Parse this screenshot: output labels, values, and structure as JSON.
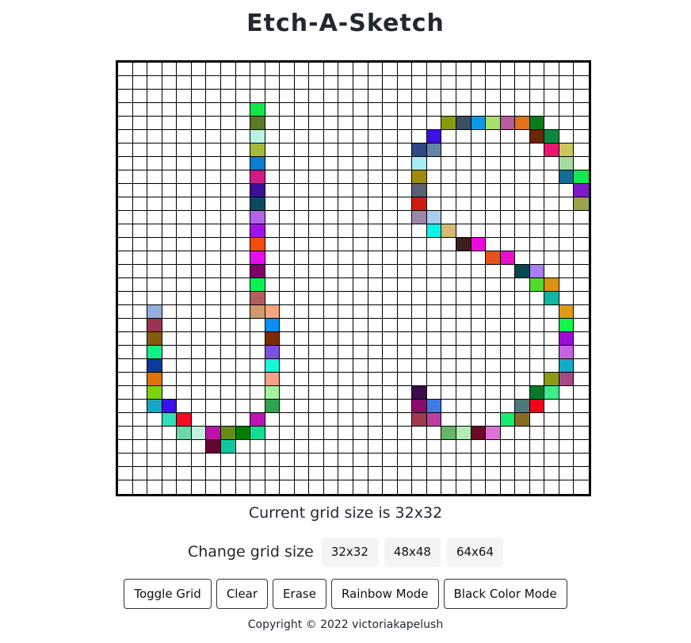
{
  "title": "Etch-A-Sketch",
  "grid": {
    "size": 32,
    "painted": [
      [
        3,
        9,
        "#11e84a"
      ],
      [
        4,
        9,
        "#5a7a2a"
      ],
      [
        5,
        9,
        "#b9f2e4"
      ],
      [
        6,
        9,
        "#a7b83a"
      ],
      [
        7,
        9,
        "#0a7fcf"
      ],
      [
        8,
        9,
        "#d21a86"
      ],
      [
        9,
        9,
        "#3a0f9a"
      ],
      [
        10,
        9,
        "#0b4a63"
      ],
      [
        11,
        9,
        "#b264e6"
      ],
      [
        12,
        9,
        "#a112ea"
      ],
      [
        13,
        9,
        "#f24e09"
      ],
      [
        14,
        9,
        "#e40ef0"
      ],
      [
        15,
        9,
        "#80006a"
      ],
      [
        16,
        9,
        "#09f254"
      ],
      [
        17,
        9,
        "#b1605f"
      ],
      [
        18,
        9,
        "#d09a6e"
      ],
      [
        18,
        10,
        "#f5a57c"
      ],
      [
        19,
        10,
        "#0a8ef0"
      ],
      [
        20,
        10,
        "#7b2b03"
      ],
      [
        21,
        10,
        "#7b4fe0"
      ],
      [
        22,
        10,
        "#17f8d8"
      ],
      [
        23,
        10,
        "#f5a28a"
      ],
      [
        24,
        10,
        "#a6f29c"
      ],
      [
        25,
        10,
        "#2ea44e"
      ],
      [
        26,
        9,
        "#bd16b3"
      ],
      [
        27,
        9,
        "#12dd93"
      ],
      [
        27,
        8,
        "#008000"
      ],
      [
        27,
        7,
        "#668c15"
      ],
      [
        27,
        6,
        "#bd11a9"
      ],
      [
        28,
        6,
        "#650532"
      ],
      [
        28,
        7,
        "#11c79f"
      ],
      [
        27,
        5,
        "#c6f0de"
      ],
      [
        27,
        4,
        "#6bd6a8"
      ],
      [
        26,
        4,
        "#f40b25"
      ],
      [
        26,
        3,
        "#2fdfb6"
      ],
      [
        25,
        3,
        "#3a0ff0"
      ],
      [
        24,
        2,
        "#7fd30d"
      ],
      [
        25,
        2,
        "#18a6c8"
      ],
      [
        23,
        2,
        "#e07008"
      ],
      [
        22,
        2,
        "#083b9a"
      ],
      [
        21,
        2,
        "#12f08a"
      ],
      [
        20,
        2,
        "#845b0a"
      ],
      [
        19,
        2,
        "#9a3550"
      ],
      [
        18,
        2,
        "#92aee0"
      ],
      [
        4,
        22,
        "#889b0d"
      ],
      [
        4,
        23,
        "#3b4e63"
      ],
      [
        4,
        24,
        "#0b99e3"
      ],
      [
        4,
        25,
        "#a8df6a"
      ],
      [
        4,
        26,
        "#ba5c99"
      ],
      [
        4,
        27,
        "#e0721c"
      ],
      [
        4,
        28,
        "#0b7a1b"
      ],
      [
        5,
        28,
        "#6b2703"
      ],
      [
        5,
        29,
        "#0a8a3f"
      ],
      [
        6,
        29,
        "#ec1574"
      ],
      [
        6,
        30,
        "#c9c75c"
      ],
      [
        7,
        30,
        "#a4dca4"
      ],
      [
        8,
        30,
        "#126f93"
      ],
      [
        8,
        31,
        "#13e84e"
      ],
      [
        9,
        31,
        "#7e1ac8"
      ],
      [
        10,
        31,
        "#9aa34a"
      ],
      [
        5,
        21,
        "#3d0fe3"
      ],
      [
        6,
        20,
        "#2d4a86"
      ],
      [
        6,
        21,
        "#6286a6"
      ],
      [
        7,
        20,
        "#a7edf2"
      ],
      [
        8,
        20,
        "#a08a09"
      ],
      [
        9,
        20,
        "#596173"
      ],
      [
        10,
        20,
        "#d21a14"
      ],
      [
        11,
        20,
        "#9a86a6"
      ],
      [
        11,
        21,
        "#a9cdf2"
      ],
      [
        12,
        21,
        "#0af2ea"
      ],
      [
        12,
        22,
        "#d4b973"
      ],
      [
        13,
        23,
        "#3d1d1d"
      ],
      [
        13,
        24,
        "#ec0adf"
      ],
      [
        14,
        25,
        "#e5521c"
      ],
      [
        14,
        26,
        "#ea10ca"
      ],
      [
        15,
        27,
        "#05494e"
      ],
      [
        15,
        28,
        "#a97cf8"
      ],
      [
        16,
        28,
        "#55d92e"
      ],
      [
        16,
        29,
        "#dc9211"
      ],
      [
        17,
        29,
        "#12b79f"
      ],
      [
        18,
        30,
        "#e09a13"
      ],
      [
        19,
        30,
        "#12f84a"
      ],
      [
        20,
        30,
        "#9c0ad5"
      ],
      [
        21,
        30,
        "#c664e0"
      ],
      [
        22,
        30,
        "#13adc9"
      ],
      [
        23,
        30,
        "#a74a88"
      ],
      [
        23,
        29,
        "#8c9a15"
      ],
      [
        24,
        29,
        "#3dec8a"
      ],
      [
        24,
        28,
        "#067a2a"
      ],
      [
        25,
        27,
        "#4d797c"
      ],
      [
        25,
        28,
        "#f4021c"
      ],
      [
        26,
        27,
        "#8c6a24"
      ],
      [
        26,
        26,
        "#19ec6c"
      ],
      [
        27,
        24,
        "#6b0a2a"
      ],
      [
        27,
        25,
        "#dc73d2"
      ],
      [
        27,
        23,
        "#b2ecb3"
      ],
      [
        27,
        22,
        "#65b56a"
      ],
      [
        26,
        21,
        "#bd3da1"
      ],
      [
        26,
        20,
        "#a03a4a"
      ],
      [
        25,
        20,
        "#8a0d6e"
      ],
      [
        25,
        21,
        "#3d7ae5"
      ],
      [
        24,
        20,
        "#3d0d4a"
      ]
    ]
  },
  "grid_size_text": "Current grid size is 32x32",
  "change_label": "Change grid size",
  "size_buttons": [
    "32x32",
    "48x48",
    "64x64"
  ],
  "mode_buttons": {
    "toggle": "Toggle Grid",
    "clear": "Clear",
    "erase": "Erase",
    "rainbow": "Rainbow Mode",
    "black": "Black Color Mode"
  },
  "footer": "Copyright © 2022 victoriakapelush"
}
